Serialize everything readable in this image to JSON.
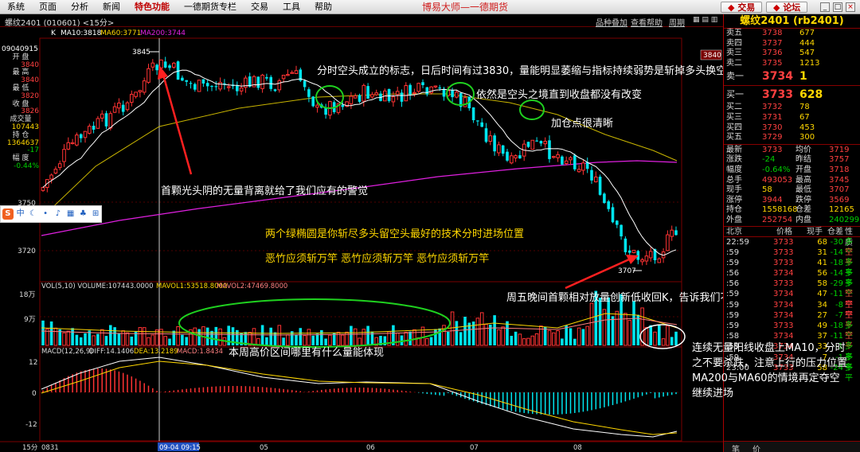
{
  "menu": {
    "items": [
      "系统",
      "页面",
      "分析",
      "新闻",
      "特色功能",
      "一德期货专栏",
      "交易",
      "工具",
      "帮助"
    ],
    "active_index": 4,
    "app_title": "博易大师—一德期货",
    "trade_button": "交易",
    "forum_button": "论坛"
  },
  "chart_header": {
    "symbol": "螺纹2401 (010601) <15分>",
    "links": [
      "品种叠加",
      "查看帮助",
      "周期"
    ]
  },
  "main_chart": {
    "ma_line_prefix": "K",
    "ma10": "MA10:3818",
    "ma60": "MA60:3771",
    "ma200": "MA200:3744",
    "high_marker": "3845",
    "low_marker": "3707",
    "current_price_tag": "3840",
    "price_labels": [
      "3750",
      "3720"
    ]
  },
  "info_column": {
    "date": "09040915",
    "rows": [
      {
        "label": "开 盘",
        "value": "3840",
        "color": "r"
      },
      {
        "label": "最 高",
        "value": "3840",
        "color": "r"
      },
      {
        "label": "最 低",
        "value": "3820",
        "color": "r"
      },
      {
        "label": "收 盘",
        "value": "3826",
        "color": "r"
      },
      {
        "label": "成交量",
        "value": "107443",
        "color": ""
      },
      {
        "label": "持 仓",
        "value": "1364637",
        "color": ""
      },
      {
        "label": "",
        "value": "-17",
        "color": "g"
      },
      {
        "label": "幅 度",
        "value": "-0.44%",
        "color": "g"
      }
    ]
  },
  "volume_panel": {
    "label_vol": "VOL(5,10) VOLUME:107443.0000",
    "label_mavol1": "MAVOL1:53518.8000",
    "label_mavol2": "MAVOL2:47469.8000",
    "axis": [
      "18万",
      "9万"
    ]
  },
  "macd_panel": {
    "label_macd": "MACD(12,26,9)",
    "label_diff": "DIFF:14.1406",
    "label_dea": "DEA:13.2189",
    "label_macd_val": "MACD:1.8434",
    "axis": [
      "12",
      "0",
      "-12"
    ]
  },
  "time_axis": {
    "period": "15分",
    "labels": [
      "0831",
      "09-04 09:15",
      "05",
      "06",
      "07",
      "08"
    ]
  },
  "annotations": {
    "a1": "分时空头成立的标志，日后时间有过3830，量能明显萎缩与指标持续弱势是斩掉多头换空绝好时机",
    "a2": "依然是空头之境直到收盘都没有改变",
    "a3": "加仓点很清晰",
    "a4": "首颗光头阴的无量背离就给了我们应有的警觉",
    "a5": "两个绿椭圆是你斩尽多头留空头最好的技术分时进场位置",
    "a6": "恶竹应须斩万竿  恶竹应须斩万竿  恶竹应须斩万竿",
    "a7": "周五晚间首颗相对放量创新低收回K，告诉我们不再杀跌",
    "a8": "本周高价区间哪里有什么量能体现",
    "a9": "连续无量阳线收盘上MA10，分时",
    "a10": "之不要杀跌，注意上行的压力位置",
    "a11": "MA200与MA60的情境再定夺空",
    "a12": "继续进场"
  },
  "quote_panel": {
    "title": "螺纹2401 (rb2401)",
    "asks": [
      {
        "label": "卖五",
        "price": "3738",
        "vol": "677"
      },
      {
        "label": "卖四",
        "price": "3737",
        "vol": "444"
      },
      {
        "label": "卖三",
        "price": "3736",
        "vol": "547"
      },
      {
        "label": "卖二",
        "price": "3735",
        "vol": "1213"
      },
      {
        "label": "卖一",
        "price": "3734",
        "vol": "1"
      }
    ],
    "bids": [
      {
        "label": "买一",
        "price": "3733",
        "vol": "628"
      },
      {
        "label": "买二",
        "price": "3732",
        "vol": "78"
      },
      {
        "label": "买三",
        "price": "3731",
        "vol": "67"
      },
      {
        "label": "买四",
        "price": "3730",
        "vol": "453"
      },
      {
        "label": "买五",
        "price": "3729",
        "vol": "300"
      }
    ],
    "stats": [
      [
        "最新",
        "3733",
        "均价",
        "3719"
      ],
      [
        "涨跌",
        "-24",
        "昨结",
        "3757"
      ],
      [
        "幅度",
        "-0.64%",
        "开盘",
        "3718"
      ],
      [
        "总手",
        "493053",
        "最高",
        "3745"
      ],
      [
        "现手",
        "58",
        "最低",
        "3707"
      ],
      [
        "涨停",
        "3944",
        "跌停",
        "3569"
      ],
      [
        "持仓",
        "1558168",
        "仓差",
        "12165"
      ],
      [
        "外盘",
        "252754",
        "内盘",
        "240299"
      ]
    ],
    "tick_header": [
      "北京",
      "价格",
      "现手",
      "仓差",
      "性质"
    ],
    "ticks": [
      {
        "t": "22:59",
        "p": "3733",
        "v": "68",
        "o": "-30",
        "y": "多平",
        "g": true
      },
      {
        "t": ":59",
        "p": "3733",
        "v": "31",
        "o": "-14",
        "y": "空平",
        "g": false
      },
      {
        "t": ":59",
        "p": "3733",
        "v": "41",
        "o": "-18",
        "y": "多平",
        "g": true
      },
      {
        "t": ":56",
        "p": "3734",
        "v": "56",
        "o": "-14",
        "y": "多平",
        "g": true
      },
      {
        "t": ":56",
        "p": "3733",
        "v": "58",
        "o": "-29",
        "y": "多平",
        "g": true
      },
      {
        "t": ":59",
        "p": "3734",
        "v": "47",
        "o": "-11",
        "y": "空平",
        "g": false
      },
      {
        "t": ":59",
        "p": "3734",
        "v": "34",
        "o": "-8",
        "y": "空平",
        "g": false
      },
      {
        "t": ":59",
        "p": "3734",
        "v": "27",
        "o": "-7",
        "y": "空平",
        "g": false
      },
      {
        "t": ":59",
        "p": "3733",
        "v": "49",
        "o": "-18",
        "y": "多平",
        "g": true
      },
      {
        "t": ":58",
        "p": "3734",
        "v": "37",
        "o": "-11",
        "y": "空平",
        "g": false
      },
      {
        "t": ":59",
        "p": "3734",
        "v": "33",
        "o": "-1",
        "y": "多平",
        "g": true
      },
      {
        "t": ":59",
        "p": "3734",
        "v": "7",
        "o": "-1",
        "y": "多平",
        "g": true
      },
      {
        "t": "23:00",
        "p": "3733",
        "v": "58",
        "o": "-24",
        "y": "多平",
        "g": true
      }
    ],
    "footer": [
      "笔",
      "价"
    ]
  },
  "colors": {
    "up": "#ff3333",
    "down": "#00e5ee",
    "ma10": "#ffffff",
    "ma60": "#c8b400",
    "ma200": "#e020e0",
    "ellipse": "#1fd01f",
    "arrow": "#ff2020"
  }
}
